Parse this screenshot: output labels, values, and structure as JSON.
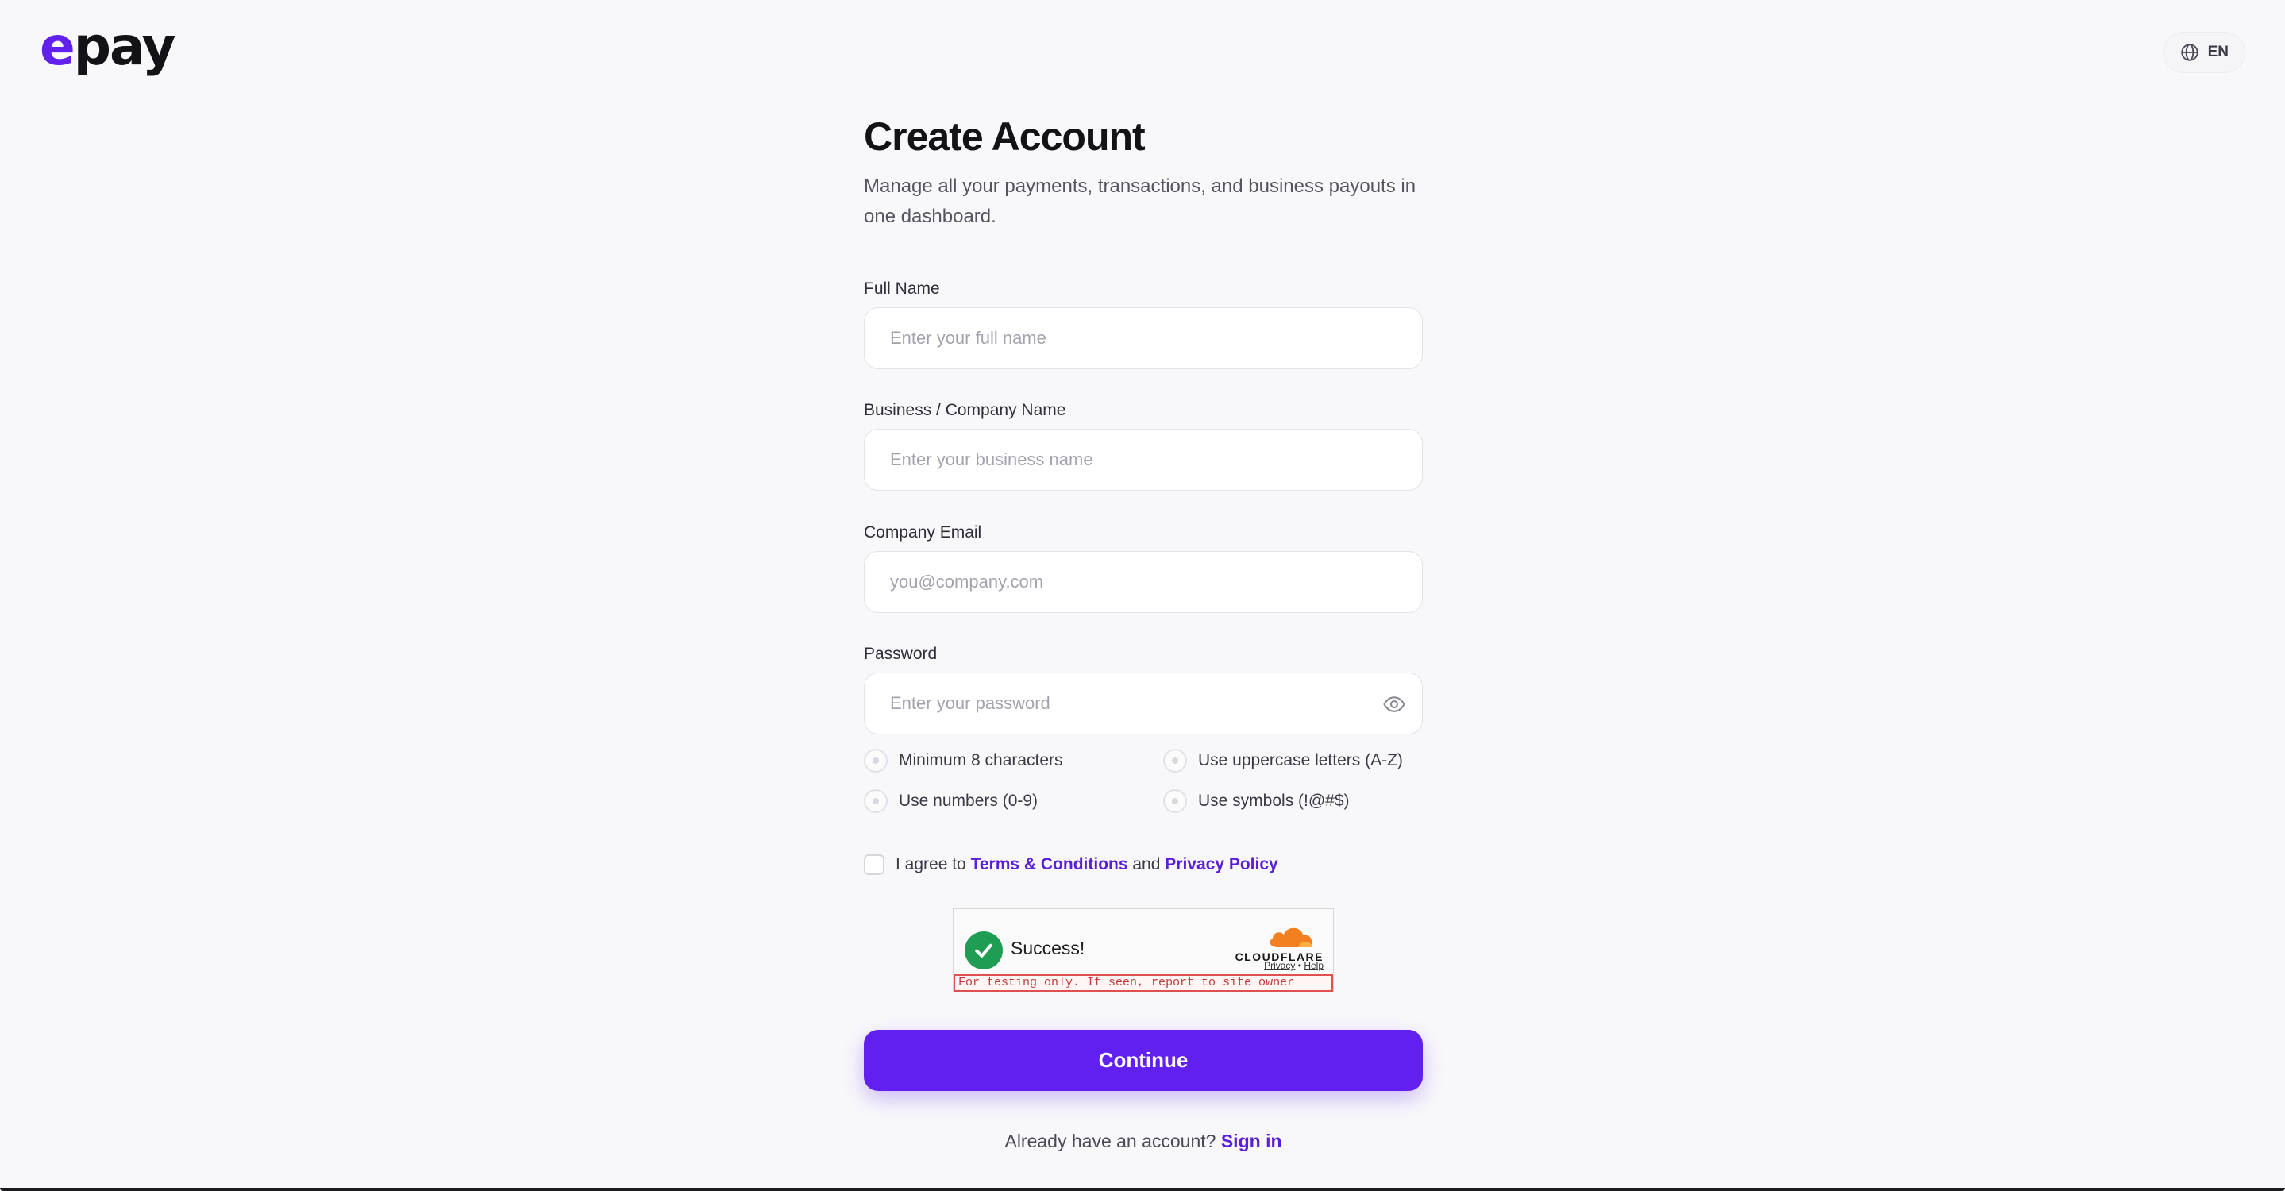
{
  "brand": {
    "logo_mark": "e",
    "logo_rest": "pay",
    "accent": "#611ff0"
  },
  "header": {
    "language": "EN",
    "language_icon": "globe-icon"
  },
  "form": {
    "title": "Create Account",
    "subtitle": "Manage all your payments, transactions, and business payouts in one dashboard.",
    "fields": {
      "full_name": {
        "label": "Full Name",
        "placeholder": "Enter your full name",
        "value": ""
      },
      "business_name": {
        "label": "Business / Company Name",
        "placeholder": "Enter your business name",
        "value": ""
      },
      "email": {
        "label": "Company Email",
        "placeholder": "you@company.com",
        "value": ""
      },
      "password": {
        "label": "Password",
        "placeholder": "Enter your password",
        "value": "",
        "toggle_icon": "eye-icon"
      }
    },
    "password_rules": [
      {
        "label": "Minimum 8 characters",
        "met": false
      },
      {
        "label": "Use uppercase letters (A-Z)",
        "met": false
      },
      {
        "label": "Use numbers (0-9)",
        "met": false
      },
      {
        "label": "Use symbols (!@#$)",
        "met": false
      }
    ],
    "agreement": {
      "prefix": "I agree to",
      "terms_link": "Terms & Conditions",
      "conjunction": "and",
      "privacy_link": "Privacy Policy",
      "checked": false
    },
    "captcha": {
      "status": "Success!",
      "brand": "CLOUDFLARE",
      "privacy_link": "Privacy",
      "separator": "•",
      "help_link": "Help",
      "test_notice": "For testing only. If seen, report to site owner"
    },
    "submit_label": "Continue",
    "signin": {
      "prompt": "Already have an account?",
      "link": "Sign in"
    }
  }
}
